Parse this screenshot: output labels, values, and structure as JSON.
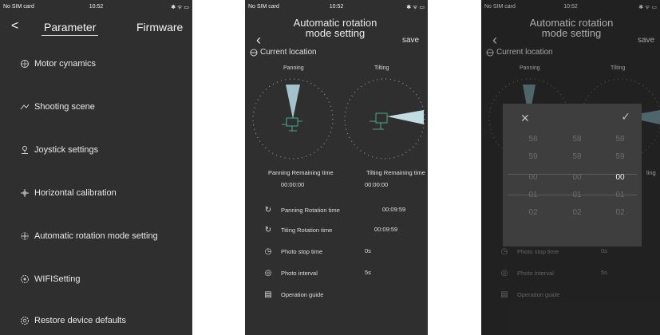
{
  "statusbar": {
    "carrier": "No SIM card",
    "time": "10:52",
    "sys": "✱ ᯤ ▭"
  },
  "screen1": {
    "back": "<",
    "tab_active": "Parameter",
    "tab_other": "Firmware",
    "items": [
      {
        "icon": "motor-icon",
        "label": "Motor cynamics"
      },
      {
        "icon": "scene-icon",
        "label": "Shooting scene"
      },
      {
        "icon": "joystick-icon",
        "label": "Joystick settings"
      },
      {
        "icon": "calibration-icon",
        "label": "Horizontal calibration"
      },
      {
        "icon": "rotation-icon",
        "label": "Automatic rotation mode setting"
      },
      {
        "icon": "wifi-icon",
        "label": "WIFISetting"
      },
      {
        "icon": "restore-icon",
        "label": "Restore device defaults"
      }
    ]
  },
  "screen2": {
    "title": "Automatic rotation mode setting",
    "save": "save",
    "current_location": "Current location",
    "panning_label": "Panning",
    "tilting_label": "Tilting",
    "panning_remaining_label": "Panning Remaining time",
    "panning_remaining_value": "00:00:00",
    "tilting_remaining_label": "Tilting Remaining time",
    "tilting_remaining_value": "00:00:00",
    "rows": [
      {
        "icon": "clock-icon",
        "label": "Panning Rotation time",
        "value": "00:09:59"
      },
      {
        "icon": "clock-icon",
        "label": "Titing Rotation time",
        "value": "00:09:59"
      },
      {
        "icon": "timer-icon",
        "label": "Photo stop time",
        "value": "0s"
      },
      {
        "icon": "camera-icon",
        "label": "Photo interval",
        "value": "5s"
      },
      {
        "icon": "book-icon",
        "label": "Operation guide",
        "value": ""
      }
    ]
  },
  "screen3": {
    "title": "Automatic rotation mode setting",
    "save": "save",
    "current_location": "Current location",
    "panning_label": "Panning",
    "tilting_label": "Tilting",
    "rows": [
      {
        "icon": "timer-icon",
        "label": "Photo stop time",
        "value": "0s"
      },
      {
        "icon": "camera-icon",
        "label": "Photo interval",
        "value": "5s"
      },
      {
        "icon": "book-icon",
        "label": "Operation guide",
        "value": ""
      }
    ],
    "picker": {
      "cancel": "✕",
      "confirm": "✓",
      "columns": [
        [
          "58",
          "59",
          "00",
          "01",
          "02"
        ],
        [
          "58",
          "59",
          "00",
          "01",
          "02"
        ],
        [
          "58",
          "59",
          "00",
          "01",
          "02"
        ]
      ],
      "partial_text": "ling"
    }
  },
  "colors": {
    "background": "#2f2f2f",
    "text": "#e6e6e6",
    "accent_cyan": "#9fe3f0",
    "model_green": "#4fc7a6"
  }
}
